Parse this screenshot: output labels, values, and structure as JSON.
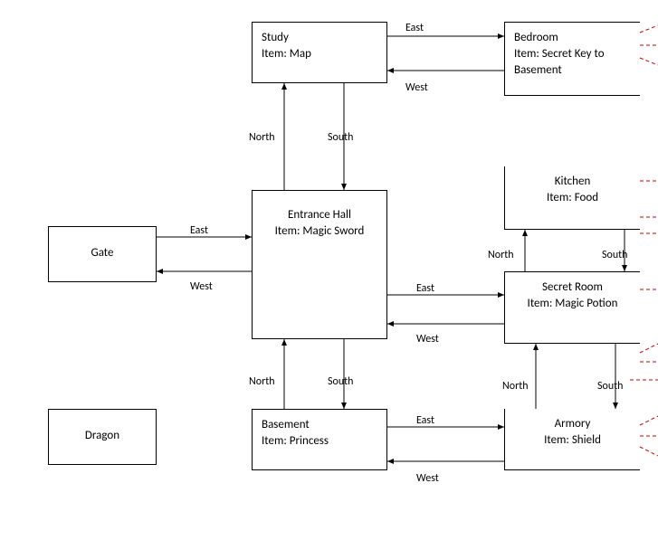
{
  "rooms": {
    "study": {
      "title": "Study",
      "item": "Item: Map"
    },
    "bedroom": {
      "title": "Bedroom",
      "item": "Item: Secret Key to Basement"
    },
    "gate": {
      "title": "Gate",
      "item": ""
    },
    "entrance": {
      "title": "Entrance Hall",
      "item": "Item: Magic Sword"
    },
    "kitchen": {
      "title": "Kitchen",
      "item": "Item: Food"
    },
    "secretroom": {
      "title": "Secret Room",
      "item": "Item: Magic Potion"
    },
    "basement": {
      "title": "Basement",
      "item": "Item: Princess"
    },
    "armory": {
      "title": "Armory",
      "item": "Item: Shield"
    },
    "dragon": {
      "title": "Dragon",
      "item": ""
    }
  },
  "labels": {
    "east": "East",
    "west": "West",
    "north": "North",
    "south": "South"
  }
}
